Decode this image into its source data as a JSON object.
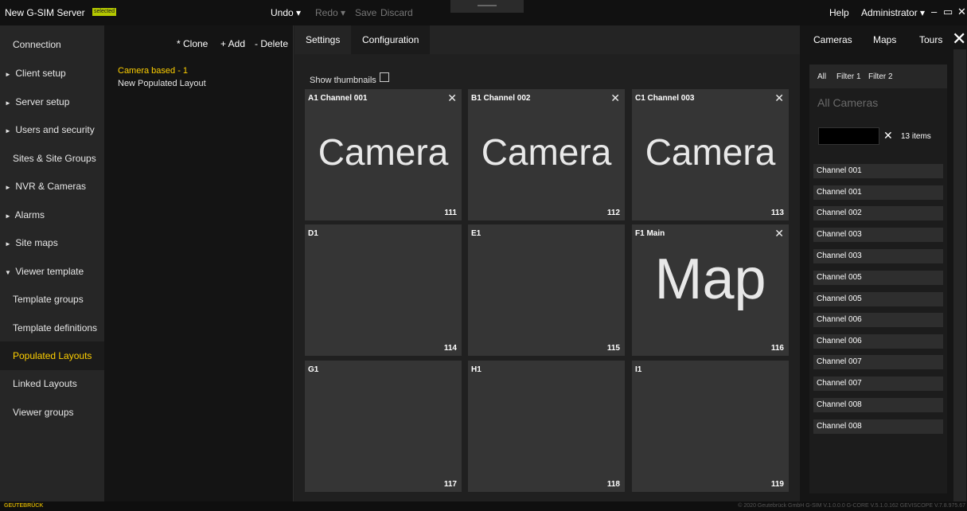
{
  "app": {
    "title": "New G-SIM Server",
    "badge": "selected"
  },
  "toolbar": {
    "undo": "Undo ▾",
    "redo": "Redo ▾",
    "save": "Save",
    "discard": "Discard",
    "help": "Help",
    "user": "Administrator ▾"
  },
  "nav": {
    "items": [
      {
        "label": "Connection"
      },
      {
        "label": "Client setup",
        "caret": "►"
      },
      {
        "label": "Server setup",
        "caret": "►"
      },
      {
        "label": "Users and security",
        "caret": "►"
      },
      {
        "label": "Sites & Site Groups"
      },
      {
        "label": "NVR & Cameras",
        "caret": "►"
      },
      {
        "label": "Alarms",
        "caret": "►"
      },
      {
        "label": "Site maps",
        "caret": "►"
      },
      {
        "label": "Viewer template",
        "caret": "▼"
      },
      {
        "label": "Template groups"
      },
      {
        "label": "Template definitions"
      },
      {
        "label": "Populated Layouts",
        "active": true
      },
      {
        "label": "Linked Layouts"
      },
      {
        "label": "Viewer groups"
      }
    ]
  },
  "list_panel": {
    "clone": "* Clone",
    "add": "+ Add",
    "delete": "- Delete",
    "layouts": [
      "Camera based - 1",
      "New Populated Layout"
    ]
  },
  "tabs": {
    "settings": "Settings",
    "configuration": "Configuration"
  },
  "grid": {
    "show_thumbnails": "Show thumbnails",
    "close_glyph": "✕",
    "tiles": [
      {
        "name": "A1  Channel 001",
        "number": "111",
        "big": "Camera",
        "closable": true
      },
      {
        "name": "B1  Channel 002",
        "number": "112",
        "big": "Camera",
        "closable": true
      },
      {
        "name": "C1  Channel 003",
        "number": "113",
        "big": "Camera",
        "closable": true
      },
      {
        "name": "D1",
        "number": "114",
        "big": ""
      },
      {
        "name": "E1",
        "number": "115",
        "big": ""
      },
      {
        "name": "F1  Main",
        "number": "116",
        "big": "Map",
        "closable": true
      },
      {
        "name": "G1",
        "number": "117",
        "big": ""
      },
      {
        "name": "H1",
        "number": "118",
        "big": ""
      },
      {
        "name": "I1",
        "number": "119",
        "big": ""
      }
    ]
  },
  "right_panel": {
    "tabs": [
      "Cameras",
      "Maps",
      "Tours"
    ],
    "filters": [
      "All",
      "Filter 1",
      "Filter 2"
    ],
    "heading": "All Cameras",
    "count": "13 items",
    "clear_glyph": "✕",
    "close_glyph": "✕",
    "channels": [
      "Channel 001",
      "Channel 001",
      "Channel 002",
      "Channel 003",
      "Channel 003",
      "Channel 005",
      "Channel 005",
      "Channel 006",
      "Channel 006",
      "Channel 007",
      "Channel 007",
      "Channel 008",
      "Channel 008"
    ]
  },
  "window_controls": {
    "minimize": "–",
    "maximize": "▭",
    "close": "✕"
  },
  "footer": {
    "brand": "GEUTEBRÜCK",
    "versions": "© 2020 Geutebrück GmbH   G-SIM V.1.0.0.0   G-CORE V.5.1.0.162   GEVISCOPE V.7.8.975.67"
  }
}
